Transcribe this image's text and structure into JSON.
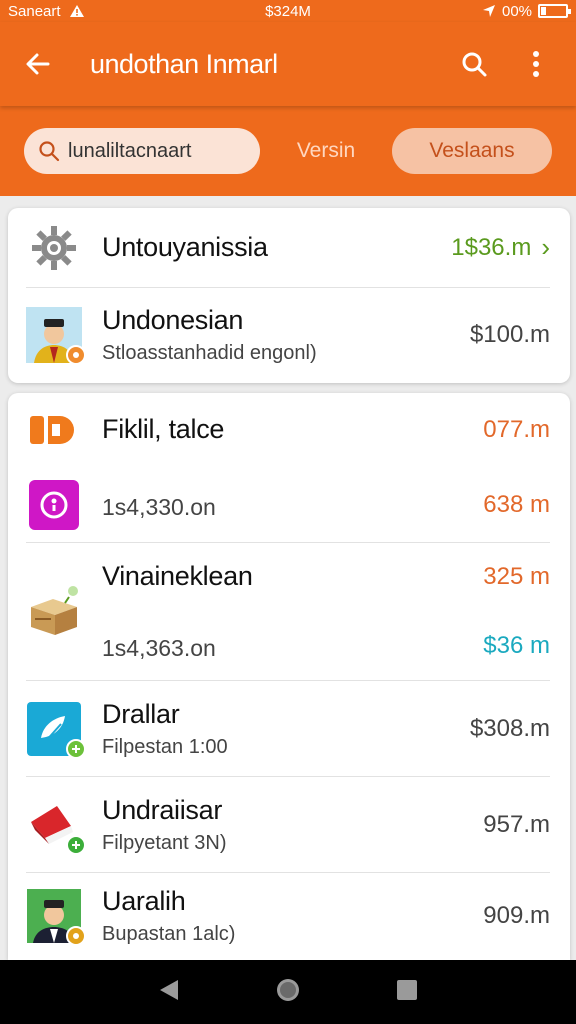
{
  "status": {
    "carrier": "Saneart",
    "time": "$324M",
    "battery": "00%"
  },
  "appbar": {
    "title": "undothan Inmarl",
    "back_icon": "arrow-left-icon",
    "search_icon": "search-icon",
    "menu_icon": "more-vertical-icon"
  },
  "filters": {
    "search_text": "lunaliltacnaart",
    "tab_middle": "Versin",
    "tab_active": "Veslaans"
  },
  "card1": {
    "rows": [
      {
        "name": "Untouyanissia",
        "amount": "1$36.m",
        "icon": "gear-icon"
      },
      {
        "name": "Undonesian",
        "sub": "Stloasstanhadid engonl)",
        "amount": "$100.m",
        "icon": "person-avatar-icon"
      }
    ]
  },
  "card2": {
    "rows": [
      {
        "name": "Fiklil, talce",
        "amount": "077.m",
        "sub": "1s4,330.on",
        "amount2": "638 m",
        "icon": "orange-logo-icon",
        "icon2": "purple-circle-icon"
      },
      {
        "name": "Vinaineklean",
        "amount": "325 m",
        "sub": "1s4,363.on",
        "amount2": "$36 m",
        "icon": "package-box-icon"
      },
      {
        "name": "Drallar",
        "sub": "Filpestan 1:00",
        "amount": "$308.m",
        "icon": "leaf-app-icon"
      },
      {
        "name": "Undraiisar",
        "sub": "Filpyetant 3N)",
        "amount": "957.m",
        "icon": "red-flag-icon"
      },
      {
        "name": "Uaralih",
        "sub": "Bupastan 1alc)",
        "amount": "909.m",
        "icon": "person-avatar-icon"
      }
    ]
  },
  "colors": {
    "brand": "#ee6a1c",
    "green": "#5a9a1e",
    "orange": "#e2682a",
    "teal": "#1aa9bf"
  },
  "nav": {
    "back": "triangle-back-icon",
    "home": "circle-home-icon",
    "recents": "square-recents-icon"
  }
}
